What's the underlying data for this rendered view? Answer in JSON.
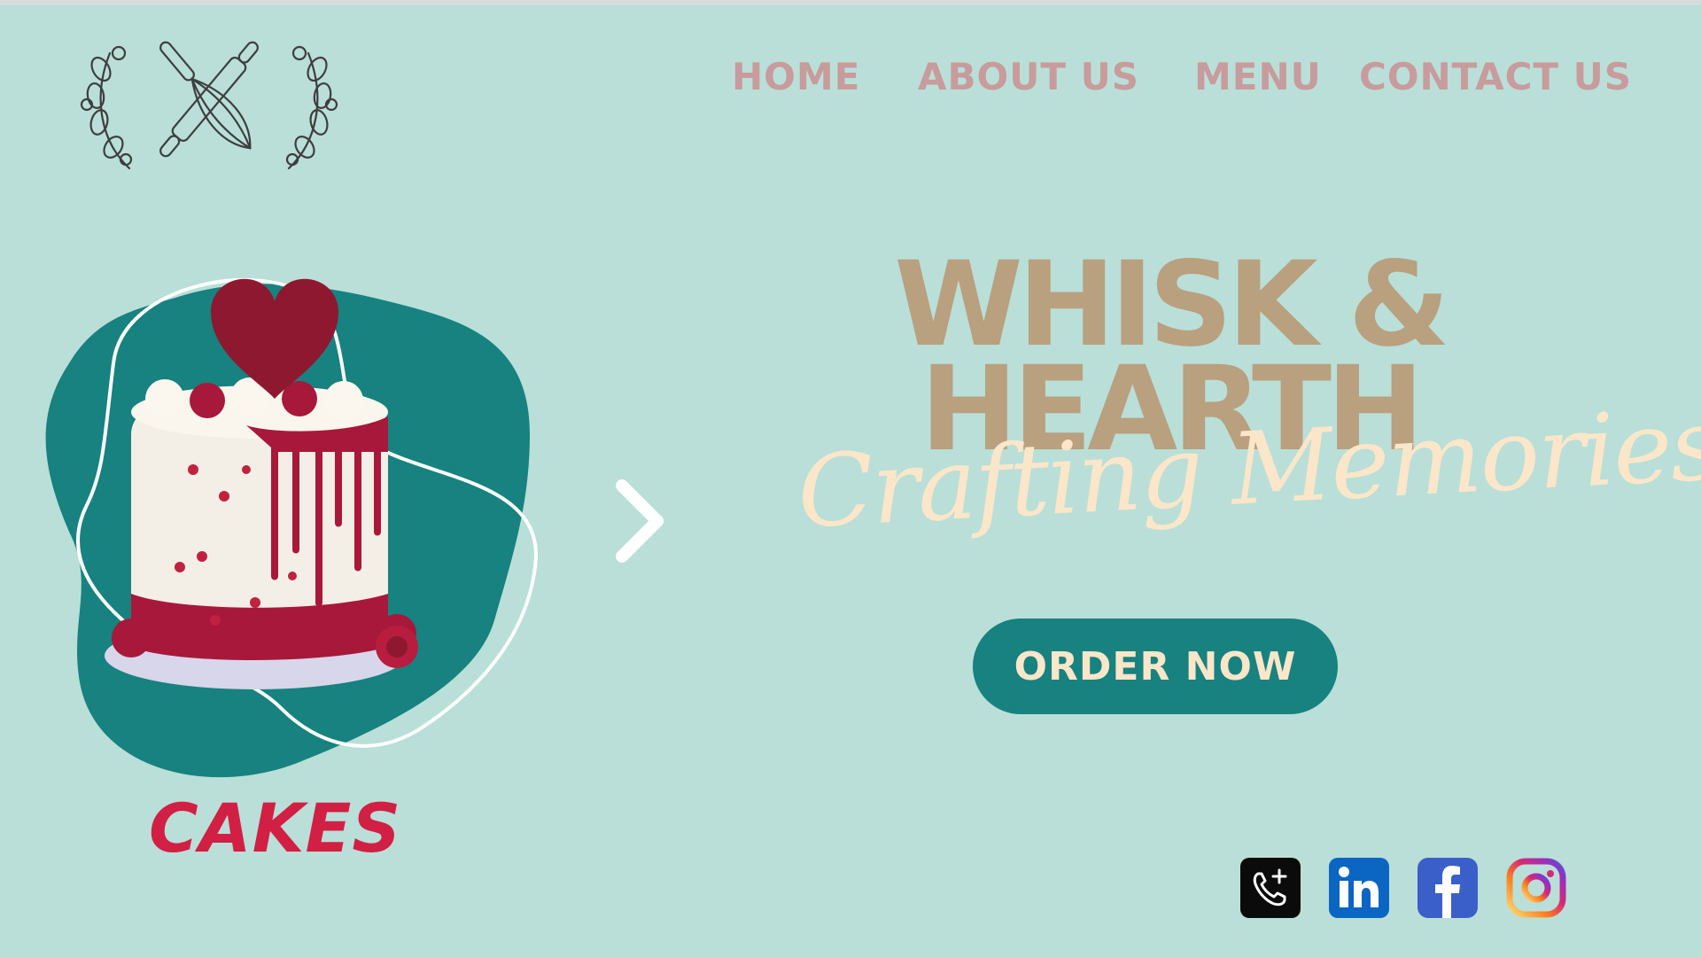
{
  "nav": {
    "items": [
      {
        "label": "HOME"
      },
      {
        "label": "ABOUT  US"
      },
      {
        "label": "MENU"
      },
      {
        "label": "CONTACT US"
      }
    ]
  },
  "hero": {
    "brand_line1": "WHISK &",
    "brand_line2": "HEARTH",
    "tagline": "Crafting Memories",
    "order_button": "ORDER NOW"
  },
  "carousel": {
    "category_label": "CAKES",
    "next_icon": "chevron-right-icon"
  },
  "logo": {
    "icon": "crossed-rolling-pin-whisk-icon"
  },
  "social": [
    {
      "icon": "phone-icon"
    },
    {
      "icon": "linkedin-icon"
    },
    {
      "icon": "facebook-icon"
    },
    {
      "icon": "instagram-icon"
    }
  ],
  "colors": {
    "background": "#b9dfd8",
    "nav_text": "#c89b9d",
    "brand_text": "#b9a07e",
    "tagline_text": "#fbe6c9",
    "button_bg": "#17827f",
    "blob": "#17827f",
    "cakes_label": "#d21f44"
  }
}
